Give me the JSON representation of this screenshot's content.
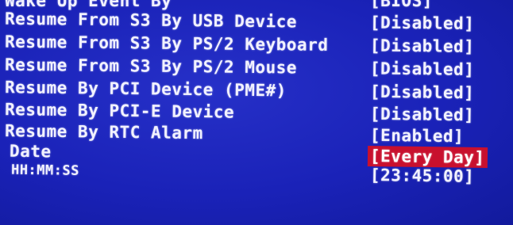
{
  "settings": [
    {
      "label": "Wake Up Event By",
      "value": "[BIOS]"
    },
    {
      "label": "Resume From S3 By USB Device",
      "value": "[Disabled]"
    },
    {
      "label": "Resume From S3 By PS/2 Keyboard",
      "value": "[Disabled]"
    },
    {
      "label": "Resume From S3 By PS/2 Mouse",
      "value": "[Disabled]"
    },
    {
      "label": "Resume By PCI Device (PME#)",
      "value": "[Disabled]"
    },
    {
      "label": "Resume By PCI-E Device",
      "value": "[Disabled]"
    },
    {
      "label": "Resume By RTC Alarm",
      "value": "[Enabled]"
    },
    {
      "label": "Date",
      "value": "[Every Day]",
      "selected": true
    },
    {
      "label": "HH:MM:SS",
      "value": "[23:45:00]"
    }
  ],
  "colors": {
    "background": "#1a22b8",
    "text": "#f2f2ff",
    "highlight": "#c8102e"
  }
}
